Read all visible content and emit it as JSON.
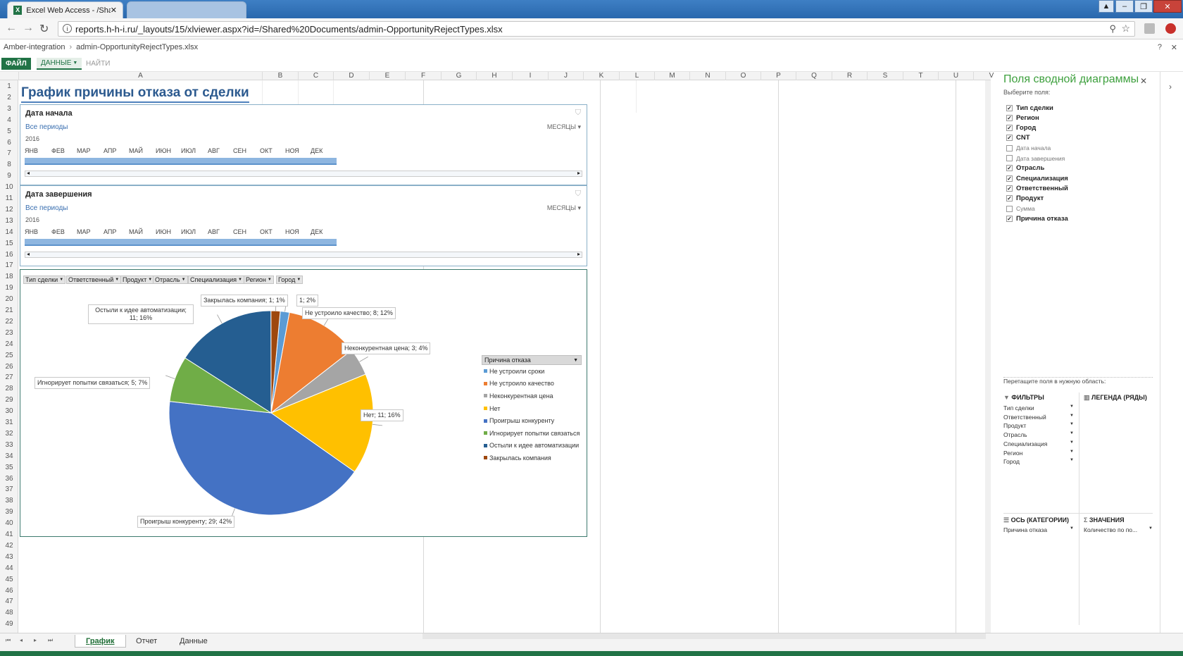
{
  "browser": {
    "tab_title": "Excel Web Access - /Shar",
    "address": "reports.h-h-i.ru/_layouts/15/xlviewer.aspx?id=/Shared%20Documents/admin-OpportunityRejectTypes.xlsx"
  },
  "breadcrumb": {
    "site": "Amber-integration",
    "file": "admin-OpportunityRejectTypes.xlsx"
  },
  "ribbon": {
    "file": "ФАЙЛ",
    "data": "ДАННЫЕ",
    "find": "НАЙТИ"
  },
  "columns": [
    "A",
    "B",
    "C",
    "D",
    "E",
    "F",
    "G",
    "H",
    "I",
    "J",
    "K",
    "L",
    "M",
    "N",
    "O",
    "P",
    "Q",
    "R",
    "S",
    "T",
    "U",
    "V"
  ],
  "rows": [
    "1",
    "2",
    "3",
    "4",
    "5",
    "6",
    "7",
    "8",
    "9",
    "10",
    "11",
    "12",
    "13",
    "14",
    "15",
    "16",
    "17",
    "18",
    "19",
    "20",
    "21",
    "22",
    "23",
    "24",
    "25",
    "26",
    "27",
    "28",
    "29",
    "30",
    "31",
    "32",
    "33",
    "34",
    "35",
    "36",
    "37",
    "38",
    "39",
    "40",
    "41",
    "42",
    "43",
    "44",
    "45",
    "46",
    "47",
    "48",
    "49"
  ],
  "sheet_title": "График причины отказа от сделки",
  "slicer_start": {
    "title": "Дата начала",
    "all_periods": "Все периоды",
    "period_type": "МЕСЯЦЫ",
    "year": "2016",
    "months": [
      "ЯНВ",
      "ФЕВ",
      "МАР",
      "АПР",
      "МАЙ",
      "ИЮН",
      "ИЮЛ",
      "АВГ",
      "СЕН",
      "ОКТ",
      "НОЯ",
      "ДЕК"
    ]
  },
  "slicer_end": {
    "title": "Дата завершения",
    "all_periods": "Все периоды",
    "period_type": "МЕСЯЦЫ",
    "year": "2016",
    "months": [
      "ЯНВ",
      "ФЕВ",
      "МАР",
      "АПР",
      "МАЙ",
      "ИЮН",
      "ИЮЛ",
      "АВГ",
      "СЕН",
      "ОКТ",
      "НОЯ",
      "ДЕК"
    ]
  },
  "chart_filters": [
    "Тип сделки",
    "Ответственный",
    "Продукт",
    "Отрасль",
    "Специализация",
    "Регион",
    "Город"
  ],
  "chart_data": {
    "type": "pie",
    "legend_title": "Причина отказа",
    "legend_position": "right",
    "slices": [
      {
        "name": "Не устроили сроки",
        "value": 1,
        "percent": 2,
        "color": "#5b9bd5",
        "label": "1; 2%"
      },
      {
        "name": "Не устроило качество",
        "value": 8,
        "percent": 12,
        "color": "#ed7d31",
        "label": "Не устроило качество; 8; 12%"
      },
      {
        "name": "Неконкурентная цена",
        "value": 3,
        "percent": 4,
        "color": "#a5a5a5",
        "label": "Неконкурентная цена; 3; 4%"
      },
      {
        "name": "Нет",
        "value": 11,
        "percent": 16,
        "color": "#ffc000",
        "label": "Нет; 11; 16%"
      },
      {
        "name": "Проигрыш конкуренту",
        "value": 29,
        "percent": 42,
        "color": "#4472c4",
        "label": "Проигрыш конкуренту; 29; 42%"
      },
      {
        "name": "Игнорирует попытки связаться",
        "value": 5,
        "percent": 7,
        "color": "#70ad47",
        "label": "Игнорирует попытки связаться; 5; 7%"
      },
      {
        "name": "Остыли к идее автоматизации",
        "value": 11,
        "percent": 16,
        "color": "#255e91",
        "label": "Остыли к идее автоматизации; 11; 16%"
      },
      {
        "name": "Закрылась компания",
        "value": 1,
        "percent": 1,
        "color": "#9e480e",
        "label": "Закрылась компания; 1; 1%"
      }
    ]
  },
  "pivot_panel": {
    "title": "Поля сводной диаграммы",
    "subtitle": "Выберите поля:",
    "fields": [
      {
        "name": "Тип сделки",
        "checked": true
      },
      {
        "name": "Регион",
        "checked": true
      },
      {
        "name": "Город",
        "checked": true
      },
      {
        "name": "CNT",
        "checked": true
      },
      {
        "name": "Дата начала",
        "checked": false
      },
      {
        "name": "Дата завершения",
        "checked": false
      },
      {
        "name": "Отрасль",
        "checked": true
      },
      {
        "name": "Специализация",
        "checked": true
      },
      {
        "name": "Ответственный",
        "checked": true
      },
      {
        "name": "Продукт",
        "checked": true
      },
      {
        "name": "Сумма",
        "checked": false
      },
      {
        "name": "Причина отказа",
        "checked": true
      }
    ],
    "drag_hint": "Перетащите поля в нужную область:",
    "filters_title": "ФИЛЬТРЫ",
    "filters": [
      "Тип сделки",
      "Ответственный",
      "Продукт",
      "Отрасль",
      "Специализация",
      "Регион",
      "Город"
    ],
    "legend_title": "ЛЕГЕНДА (РЯДЫ)",
    "axis_title": "ОСЬ (КАТЕГОРИИ)",
    "axis_items": [
      "Причина отказа"
    ],
    "values_title": "ЗНАЧЕНИЯ",
    "values_items": [
      "Количество по по..."
    ]
  },
  "sheets": [
    "График",
    "Отчет",
    "Данные"
  ]
}
